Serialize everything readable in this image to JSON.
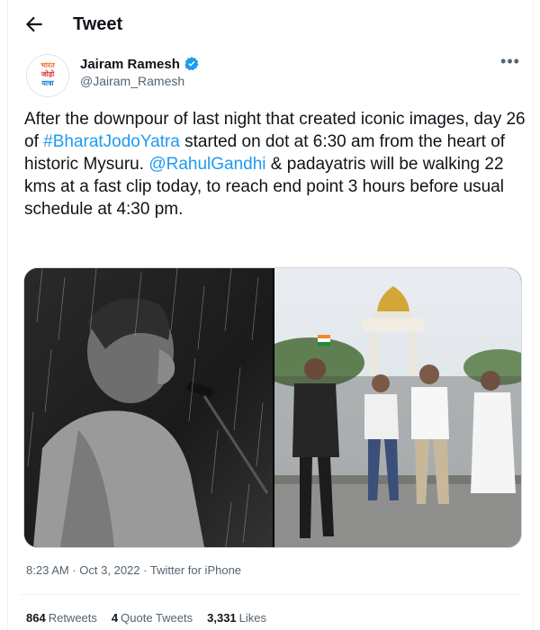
{
  "header": {
    "title": "Tweet"
  },
  "author": {
    "name": "Jairam Ramesh",
    "handle": "@Jairam_Ramesh",
    "avatar_text": [
      "भारत",
      "जोड़ो",
      "यात्रा"
    ]
  },
  "tweet": {
    "segments": [
      {
        "text": "After the downpour of last night that created iconic images, day 26 of ",
        "link": false
      },
      {
        "text": "#BharatJodoYatra",
        "link": true
      },
      {
        "text": " started on dot at 6:30 am from the heart of historic Mysuru. ",
        "link": false
      },
      {
        "text": "@RahulGandhi",
        "link": true
      },
      {
        "text": " & padayatris will be walking 22 kms at a fast clip today, to reach end point 3 hours before usual schedule at 4:30 pm.",
        "link": false
      }
    ]
  },
  "meta": {
    "time": "8:23 AM",
    "date": "Oct 3, 2022",
    "source": "Twitter for iPhone",
    "separator": "·"
  },
  "stats": [
    {
      "num": "864",
      "label": "Retweets"
    },
    {
      "num": "4",
      "label": "Quote Tweets"
    },
    {
      "num": "3,331",
      "label": "Likes"
    }
  ],
  "colors": {
    "link": "#1d9bf0",
    "verified": "#1d9bf0",
    "secondary_text": "#536471"
  },
  "icons": {
    "back": "arrow-left-icon",
    "verified": "verified-badge-icon",
    "more": "more-horizontal-icon"
  }
}
